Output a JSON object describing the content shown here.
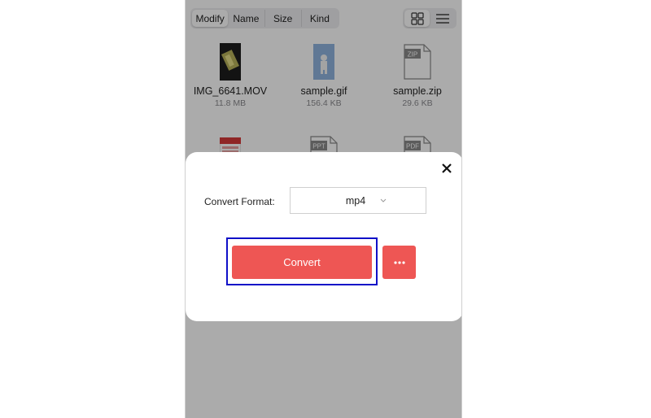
{
  "toolbar": {
    "sort_tabs": [
      "Modify",
      "Name",
      "Size",
      "Kind"
    ],
    "active_sort": "Modify",
    "view_modes": [
      "grid-view-icon",
      "list-view-icon"
    ],
    "active_view": "grid"
  },
  "files": [
    {
      "name": "IMG_6641.MOV",
      "size": "11.8 MB",
      "icon": "video-thumbnail"
    },
    {
      "name": "sample.gif",
      "size": "156.4 KB",
      "icon": "gif-thumbnail"
    },
    {
      "name": "sample.zip",
      "size": "29.6 KB",
      "icon": "zip-file-icon",
      "badge": "ZIP"
    },
    {
      "name": "",
      "size": "",
      "icon": "document-thumbnail"
    },
    {
      "name": "",
      "size": "",
      "icon": "ppt-file-icon",
      "badge": "PPT"
    },
    {
      "name": "",
      "size": "",
      "icon": "pdf-file-icon",
      "badge": "PDF"
    }
  ],
  "dialog": {
    "format_label": "Convert Format:",
    "format_value": "mp4",
    "convert_label": "Convert",
    "more_label": "···"
  },
  "colors": {
    "accent": "#ee5654",
    "highlight_box": "#1010c8",
    "overlay": "rgba(0,0,0,0.33)"
  }
}
